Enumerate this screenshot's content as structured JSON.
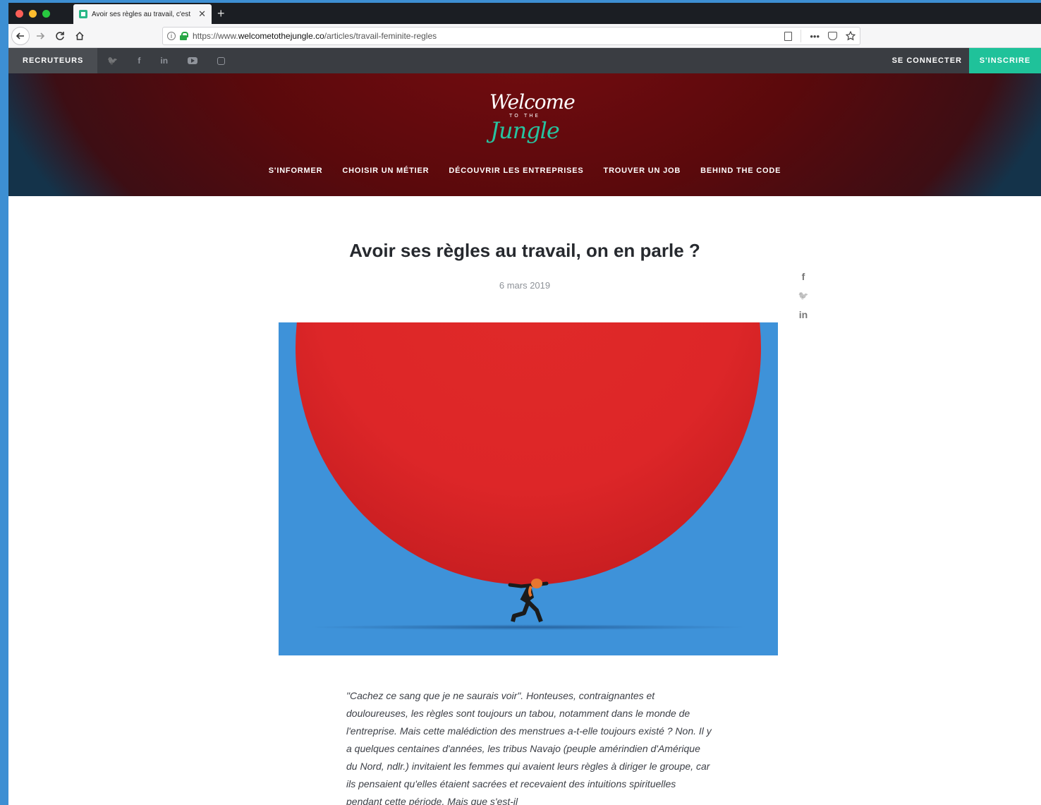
{
  "browser": {
    "tab_title": "Avoir ses règles au travail, c'est",
    "tab_close": "✕",
    "new_tab": "+",
    "url_prefix": "https://www.",
    "url_host": "welcometothejungle.co",
    "url_path": "/articles/travail-feminite-regles",
    "more_label": "•••"
  },
  "topbar": {
    "recruteurs": "RECRUTEURS",
    "social_icons": [
      "twitter-icon",
      "facebook-icon",
      "linkedin-icon",
      "youtube-icon",
      "instagram-icon"
    ],
    "twitter_glyph": "🐦",
    "facebook_glyph": "f",
    "linkedin_glyph": "in",
    "se_connecter": "SE CONNECTER",
    "sinscrire": "S'INSCRIRE"
  },
  "logo": {
    "line1": "Welcome",
    "line2": "TO THE",
    "line3": "Jungle"
  },
  "mainnav": {
    "items": [
      {
        "label": "S'INFORMER"
      },
      {
        "label": "CHOISIR UN MÉTIER"
      },
      {
        "label": "DÉCOUVRIR LES ENTREPRISES"
      },
      {
        "label": "TROUVER UN JOB"
      },
      {
        "label": "BEHIND THE CODE"
      }
    ]
  },
  "article": {
    "title": "Avoir ses règles au travail, on en parle ?",
    "date": "6 mars 2019",
    "share": {
      "facebook": "f",
      "twitter": "🐦",
      "linkedin": "in"
    },
    "intro": "\"Cachez ce sang que je ne saurais voir\". Honteuses, contraignantes et douloureuses, les règles sont toujours un tabou, notamment dans le monde de l'entreprise. Mais cette malédiction des menstrues a-t-elle toujours existé ? Non. Il y a quelques centaines d'années, les tribus Navajo (peuple amérindien d'Amérique du Nord, ndlr.) invitaient les femmes qui avaient leurs règles à diriger le groupe, car ils pensaient qu'elles étaient sacrées et recevaient des intuitions spirituelles pendant cette période. Mais que s'est-il"
  },
  "colors": {
    "accent_green": "#1fc29a",
    "hero_red": "#7a0d10",
    "image_blue": "#3e92d9",
    "ball_red": "#dd2628"
  }
}
